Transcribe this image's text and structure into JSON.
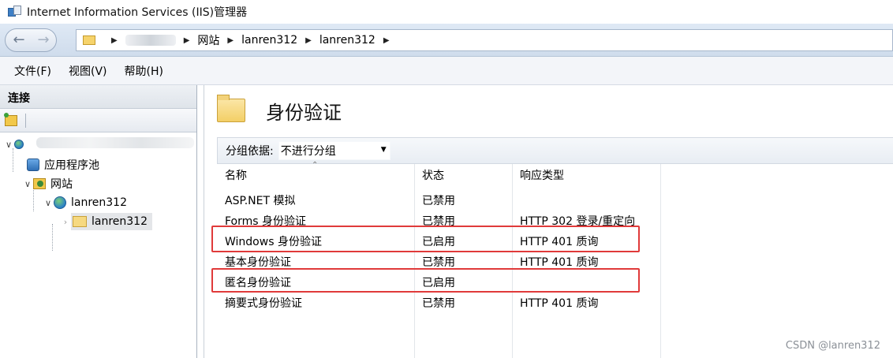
{
  "window": {
    "title": "Internet Information Services (IIS)管理器"
  },
  "address": {
    "segments": [
      "网站",
      "lanren312",
      "lanren312"
    ]
  },
  "menu": {
    "items": [
      "文件(F)",
      "视图(V)",
      "帮助(H)"
    ]
  },
  "connections": {
    "header": "连接",
    "tree": [
      {
        "label": "应用程序池"
      },
      {
        "label": "网站"
      },
      {
        "label": "lanren312"
      },
      {
        "label": "lanren312"
      }
    ]
  },
  "main": {
    "title": "身份验证",
    "group_label": "分组依据:",
    "group_value": "不进行分组",
    "columns": [
      "名称",
      "状态",
      "响应类型"
    ],
    "rows": [
      {
        "name": "ASP.NET 模拟",
        "status": "已禁用",
        "response": ""
      },
      {
        "name": "Forms 身份验证",
        "status": "已禁用",
        "response": "HTTP 302 登录/重定向"
      },
      {
        "name": "Windows 身份验证",
        "status": "已启用",
        "response": "HTTP 401 质询"
      },
      {
        "name": "基本身份验证",
        "status": "已禁用",
        "response": "HTTP 401 质询"
      },
      {
        "name": "匿名身份验证",
        "status": "已启用",
        "response": ""
      },
      {
        "name": "摘要式身份验证",
        "status": "已禁用",
        "response": "HTTP 401 质询"
      }
    ]
  },
  "watermark": "CSDN @lanren312",
  "colors": {
    "highlight": "#e03a3a",
    "address_bg": "#dfe9f5"
  }
}
